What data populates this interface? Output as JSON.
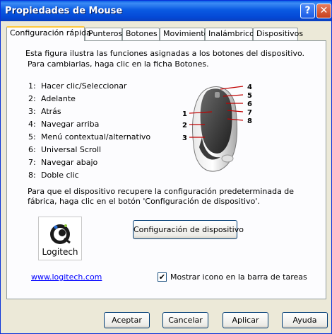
{
  "window": {
    "title": "Propiedades de Mouse",
    "help_glyph": "?",
    "close_glyph": "✕"
  },
  "tabs": [
    {
      "label": "Configuración rápida"
    },
    {
      "label": "Punteros"
    },
    {
      "label": "Botones"
    },
    {
      "label": "Movimiento"
    },
    {
      "label": "Inalámbrico"
    },
    {
      "label": "Dispositivos"
    }
  ],
  "intro": {
    "line1": "Esta figura ilustra las funciones asignadas a los botones del dispositivo.",
    "line2": "Para cambiarlas, haga clic en la ficha Botones."
  },
  "functions": [
    {
      "num": "1:",
      "label": "Hacer clic/Seleccionar"
    },
    {
      "num": "2:",
      "label": "Adelante"
    },
    {
      "num": "3:",
      "label": "Atrás"
    },
    {
      "num": "4:",
      "label": "Navegar arriba"
    },
    {
      "num": "5:",
      "label": "Menú contextual/alternativo"
    },
    {
      "num": "6:",
      "label": "Universal Scroll"
    },
    {
      "num": "7:",
      "label": "Navegar abajo"
    },
    {
      "num": "8:",
      "label": "Doble clic"
    }
  ],
  "diagram_labels": [
    "1",
    "2",
    "3",
    "4",
    "5",
    "6",
    "7",
    "8"
  ],
  "reset_text": {
    "line1": "Para que el dispositivo recupere la configuración predeterminada de",
    "line2": "fábrica, haga clic en el botón 'Configuración de dispositivo'."
  },
  "reset_button": "Configuración de dispositivo",
  "logo_text": "Logitech",
  "link": "www.logitech.com",
  "taskbar_checkbox": {
    "label": "Mostrar icono en la barra de tareas",
    "checked": true,
    "mark": "✔"
  },
  "footer": {
    "ok": "Aceptar",
    "cancel": "Cancelar",
    "apply": "Aplicar",
    "help": "Ayuda"
  },
  "colors": {
    "title_bar": "#0A5AE2",
    "dialog_bg": "#ECE9D8",
    "panel_bg": "#FCFCFE",
    "link": "#0000FF",
    "active_tab_accent": "#FFC83C"
  }
}
